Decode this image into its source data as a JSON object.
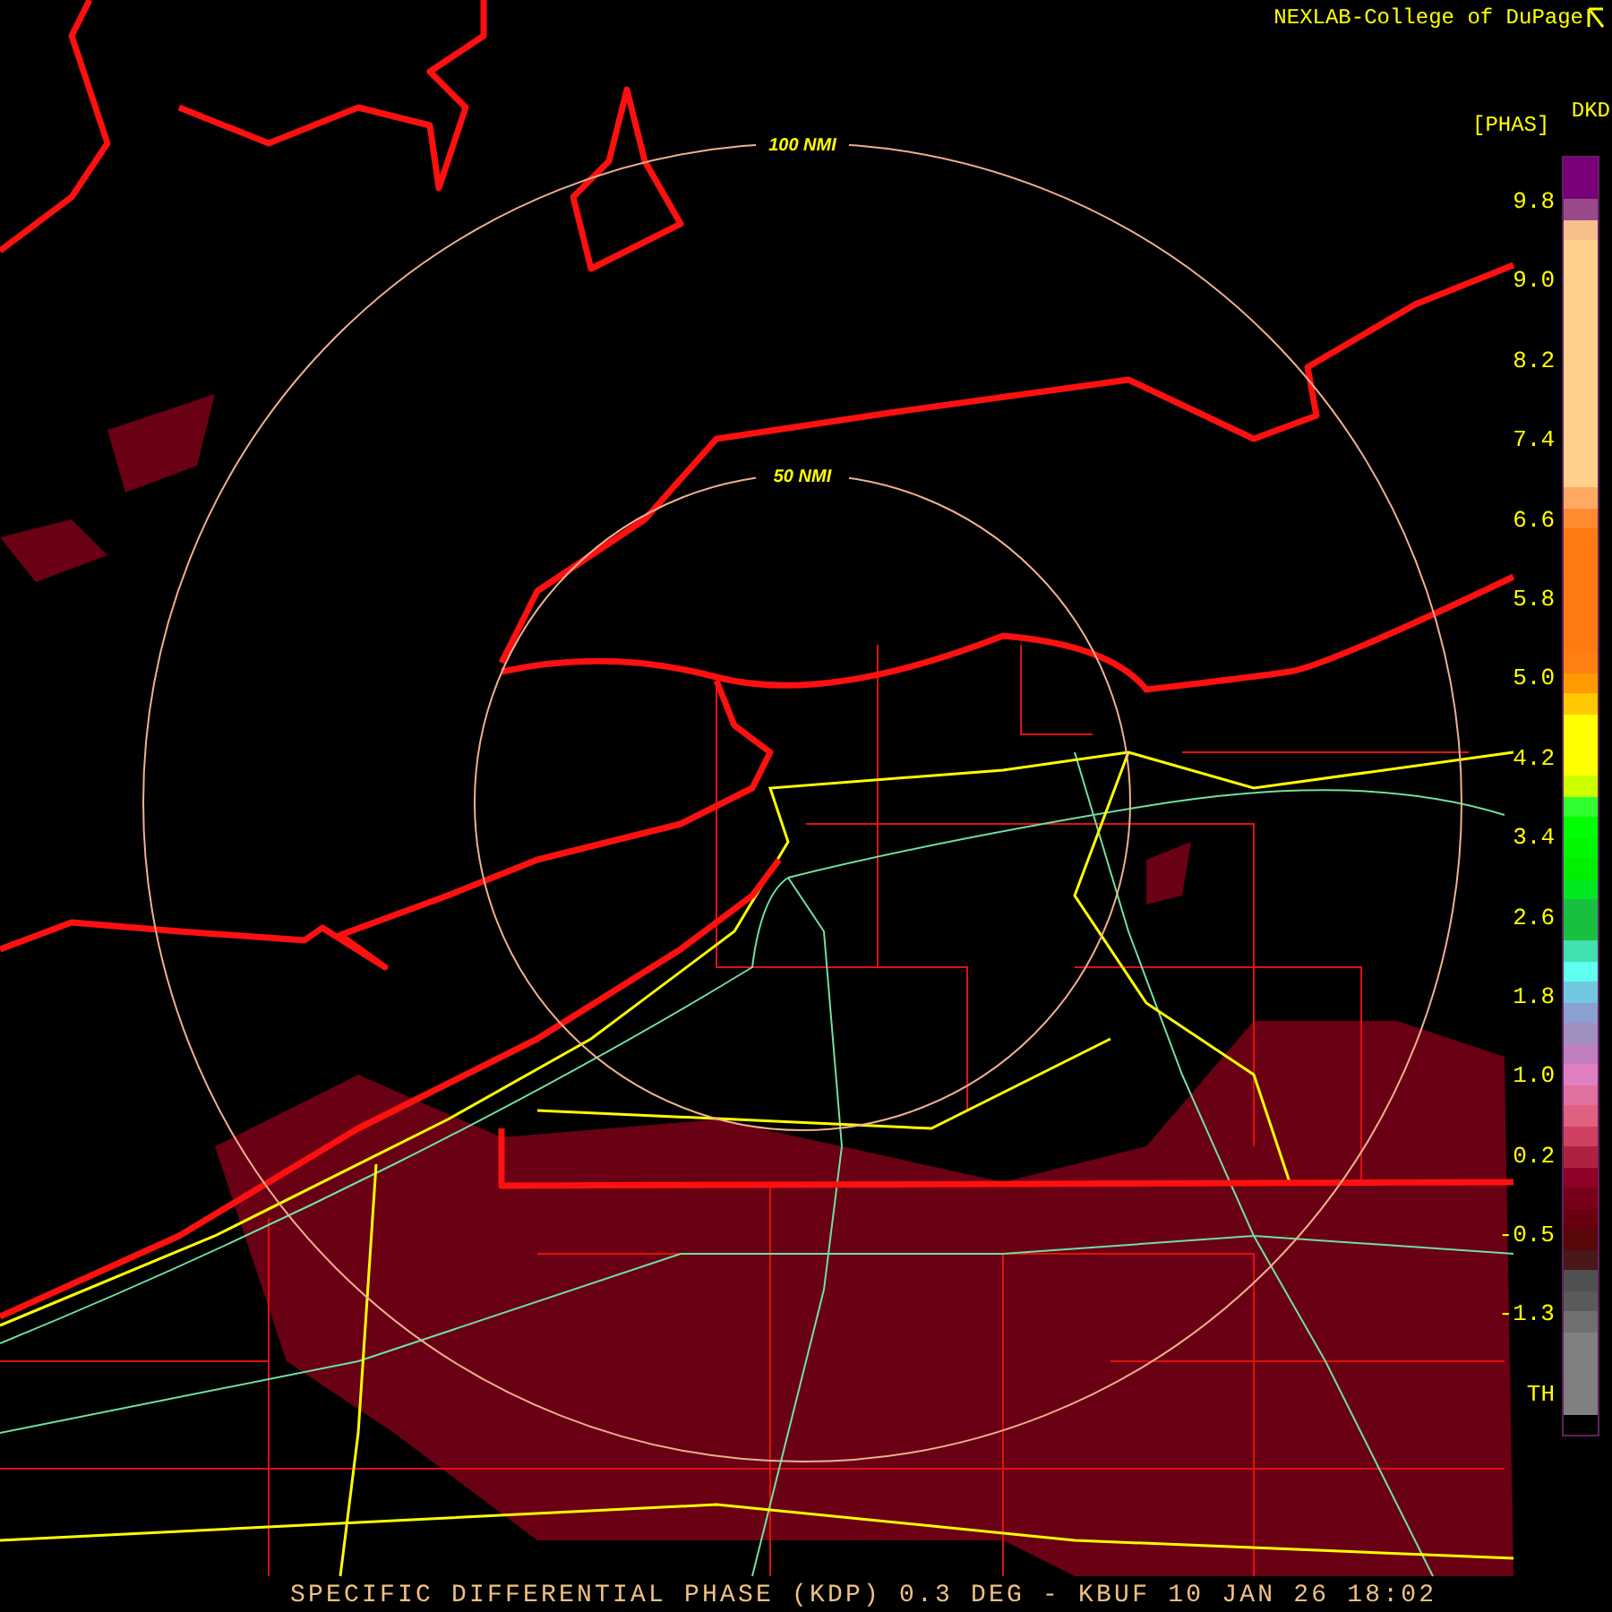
{
  "header": {
    "credit": "NEXLAB-College of DuPage",
    "product_code": "DKD",
    "unit": "[PHAS]"
  },
  "map": {
    "range_rings": [
      {
        "label": "100 NMI"
      },
      {
        "label": "50 NMI"
      }
    ]
  },
  "legend": {
    "labels": [
      "9.8",
      "9.0",
      "8.2",
      "7.4",
      "6.6",
      "5.8",
      "5.0",
      "4.2",
      "3.4",
      "2.6",
      "1.8",
      "1.0",
      "0.2",
      "-0.5",
      "-1.3",
      "TH"
    ],
    "scale": [
      {
        "color": "#780078"
      },
      {
        "color": "#780078"
      },
      {
        "color": "#9a4a8a"
      },
      {
        "color": "#f5c08a"
      },
      {
        "color": "#ffd08a"
      },
      {
        "color": "#ffd08a"
      },
      {
        "color": "#ffd08a"
      },
      {
        "color": "#ffd08a"
      },
      {
        "color": "#ffd08a"
      },
      {
        "color": "#ffd08a"
      },
      {
        "color": "#ffd08a"
      },
      {
        "color": "#ffd08a"
      },
      {
        "color": "#ffd08a"
      },
      {
        "color": "#ffd08a"
      },
      {
        "color": "#ffd08a"
      },
      {
        "color": "#ffd08a"
      },
      {
        "color": "#ffaa60"
      },
      {
        "color": "#ff8a30"
      },
      {
        "color": "#ff7a10"
      },
      {
        "color": "#ff7a10"
      },
      {
        "color": "#ff7a10"
      },
      {
        "color": "#ff7a10"
      },
      {
        "color": "#ff7a10"
      },
      {
        "color": "#ff7a10"
      },
      {
        "color": "#ff8010"
      },
      {
        "color": "#ff9a00"
      },
      {
        "color": "#ffc800"
      },
      {
        "color": "#ffff00"
      },
      {
        "color": "#ffff00"
      },
      {
        "color": "#ffff00"
      },
      {
        "color": "#ccff00"
      },
      {
        "color": "#30ff30"
      },
      {
        "color": "#00ff00"
      },
      {
        "color": "#00f800"
      },
      {
        "color": "#00f000"
      },
      {
        "color": "#00e820"
      },
      {
        "color": "#18c040"
      },
      {
        "color": "#18c040"
      },
      {
        "color": "#40e0b0"
      },
      {
        "color": "#60fff0"
      },
      {
        "color": "#70c8e0"
      },
      {
        "color": "#8aa0d0"
      },
      {
        "color": "#a090c0"
      },
      {
        "color": "#c080c0"
      },
      {
        "color": "#e080c0"
      },
      {
        "color": "#e070a0"
      },
      {
        "color": "#e06080"
      },
      {
        "color": "#d04060"
      },
      {
        "color": "#b02040"
      },
      {
        "color": "#900028"
      },
      {
        "color": "#780018"
      },
      {
        "color": "#680010"
      },
      {
        "color": "#580808"
      },
      {
        "color": "#4a1818"
      },
      {
        "color": "#505050"
      },
      {
        "color": "#5a5a5a"
      },
      {
        "color": "#707070"
      },
      {
        "color": "#808080"
      },
      {
        "color": "#808080"
      },
      {
        "color": "#808080"
      },
      {
        "color": "#808080"
      },
      {
        "color": "#000000"
      }
    ]
  },
  "footer": "SPECIFIC DIFFERENTIAL PHASE (KDP) 0.3 DEG - KBUF 10 JAN 26 18:02"
}
